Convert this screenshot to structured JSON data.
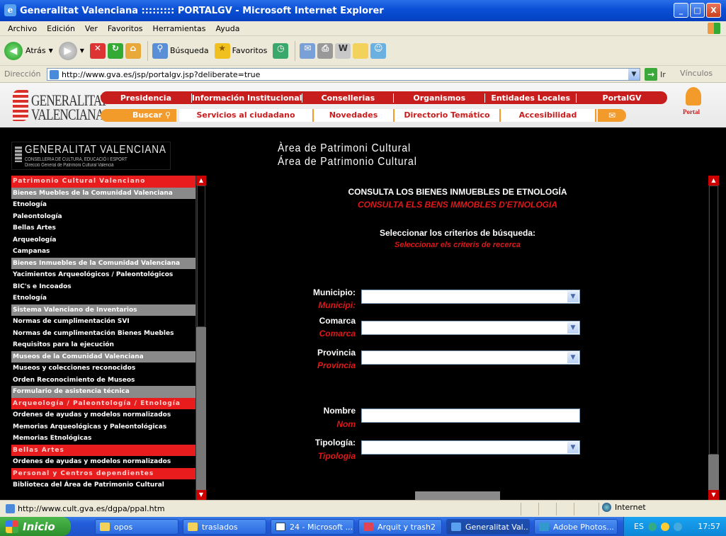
{
  "window": {
    "title": "Generalitat Valenciana ::::::::: PORTALGV - Microsoft Internet Explorer",
    "minimize": "_",
    "maximize": "□",
    "close": "X"
  },
  "menu": [
    "Archivo",
    "Edición",
    "Ver",
    "Favoritos",
    "Herramientas",
    "Ayuda"
  ],
  "toolbar": {
    "back": "Atrás",
    "search": "Búsqueda",
    "favorites": "Favoritos"
  },
  "address": {
    "label": "Dirección",
    "url": "http://www.gva.es/jsp/portalgv.jsp?deliberate=true",
    "go": "Ir",
    "links": "Vínculos"
  },
  "gva": {
    "logo_line1": "GENERALITAT",
    "logo_line2": "VALENCIANA",
    "nav1": [
      "Presidencia",
      "Información Institucional",
      "Consellerias",
      "Organismos",
      "Entidades Locales",
      "PortalGV"
    ],
    "search": "Buscar",
    "nav2": [
      "Servicios al ciudadano",
      "Novedades",
      "Directorio Temático",
      "Accesibilidad"
    ],
    "portal": "Portal"
  },
  "banner": {
    "logo_main": "GENERALITAT VALENCIANA",
    "logo_sub1": "CONSELLERIA DE CULTURA, EDUCACIÓ I ESPORT",
    "logo_sub2": "Direcció General de Patrimoni Cultural Valencià",
    "title_va": "Àrea de Patrimoni Cultural",
    "title_es": "Área de Patrimonio Cultural"
  },
  "sidebar": [
    {
      "label": "Patrimonio Cultural Valenciano",
      "kind": "red"
    },
    {
      "label": "Bienes Muebles de la Comunidad Valenciana",
      "kind": "gray"
    },
    {
      "label": "Etnología",
      "kind": "item"
    },
    {
      "label": "Paleontología",
      "kind": "item"
    },
    {
      "label": "Bellas Artes",
      "kind": "item"
    },
    {
      "label": "Arqueología",
      "kind": "item"
    },
    {
      "label": "Campanas",
      "kind": "item"
    },
    {
      "label": "Bienes Inmuebles de la Comunidad Valenciana",
      "kind": "gray"
    },
    {
      "label": "Yacimientos Arqueológicos / Paleontológicos",
      "kind": "item"
    },
    {
      "label": "BIC's e Incoados",
      "kind": "item"
    },
    {
      "label": "Etnología",
      "kind": "item"
    },
    {
      "label": "Sistema Valenciano de Inventarios",
      "kind": "gray"
    },
    {
      "label": "Normas de cumplimentación SVI",
      "kind": "item"
    },
    {
      "label": "Normas de cumplimentación Bienes Muebles",
      "kind": "item"
    },
    {
      "label": "Requisitos para la ejecución",
      "kind": "item"
    },
    {
      "label": "Museos de la Comunidad Valenciana",
      "kind": "gray"
    },
    {
      "label": "Museos y colecciones reconocidos",
      "kind": "item"
    },
    {
      "label": "Orden Reconocimiento de Museos",
      "kind": "item"
    },
    {
      "label": "Formulario de asistencia técnica",
      "kind": "gray"
    },
    {
      "label": "Arqueología / Paleontología / Etnología",
      "kind": "red"
    },
    {
      "label": "Ordenes de ayudas y modelos normalizados",
      "kind": "item"
    },
    {
      "label": "Memorias Arqueológicas y Paleontológicas",
      "kind": "item"
    },
    {
      "label": "Memorias Etnológicas",
      "kind": "item"
    },
    {
      "label": "Bellas Artes",
      "kind": "red"
    },
    {
      "label": "Ordenes de ayudas y modelos normalizados",
      "kind": "item"
    },
    {
      "label": "Personal y Centros dependientes",
      "kind": "red"
    },
    {
      "label": "Biblioteca del Área de Patrimonio Cultural",
      "kind": "item"
    }
  ],
  "form": {
    "title_es": "CONSULTA LOS BIENES INMUEBLES DE ETNOLOGÍA",
    "title_va": "CONSULTA ELS BENS IMMOBLES D'ETNOLOGIA",
    "criteria_es": "Seleccionar los criterios de búsqueda:",
    "criteria_va": "Seleccionar els criteris de recerca",
    "municipio_es": "Municipio:",
    "municipio_va": "Municipi:",
    "comarca_es": "Comarca",
    "comarca_va": "Comarca",
    "provincia_es": "Provincia",
    "provincia_va": "Provincia",
    "nombre_es": "Nombre",
    "nombre_va": "Nom",
    "tipologia_es": "Tipología:",
    "tipologia_va": "Tipologia"
  },
  "status": {
    "url": "http://www.cult.gva.es/dgpa/ppal.htm",
    "zone": "Internet"
  },
  "taskbar": {
    "start": "Inicio",
    "tasks": [
      "opos",
      "traslados",
      "24 - Microsoft ...",
      "Arquit y trash2",
      "Generalitat Val...",
      "Adobe Photos..."
    ],
    "lang": "ES",
    "clock": "17:57"
  }
}
